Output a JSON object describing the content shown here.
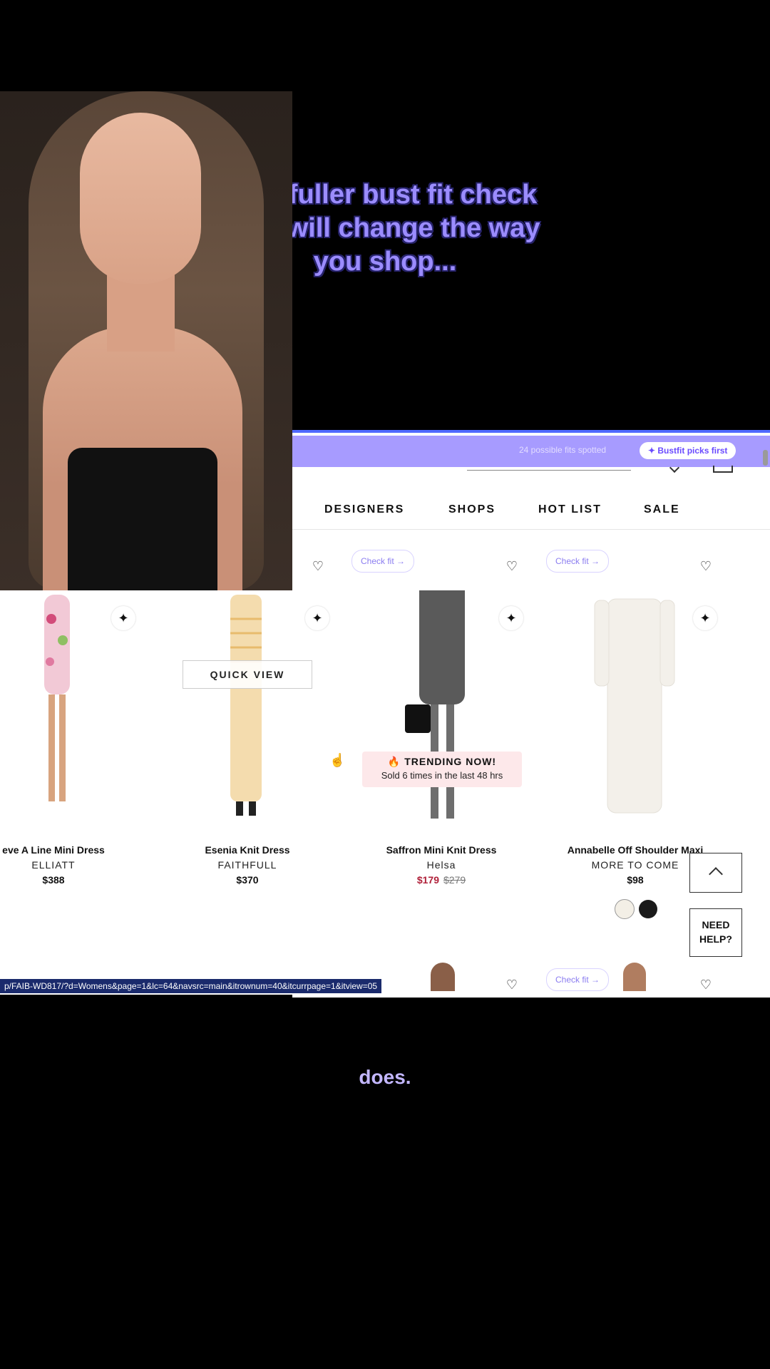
{
  "captions": {
    "top": "this fuller bust fit check tool will change the way you shop...",
    "bottom": "does."
  },
  "extension": {
    "fits_spotted": "24 possible fits spotted",
    "picks_button": "✦ Bustfit picks first"
  },
  "nav": {
    "items": [
      "DESIGNERS",
      "SHOPS",
      "HOT LIST",
      "SALE"
    ]
  },
  "products": [
    {
      "name": "eve A Line Mini Dress",
      "brand": "ELLIATT",
      "price": "$388"
    },
    {
      "name": "Esenia Knit Dress",
      "brand": "FAITHFULL",
      "price": "$370"
    },
    {
      "name": "Saffron Mini Knit Dress",
      "brand": "Helsa",
      "price": "$179",
      "original_price": "$279"
    },
    {
      "name": "Annabelle Off Shoulder Maxi",
      "brand": "MORE TO COME",
      "price": "$98"
    }
  ],
  "check_fit_label": "Check fit →",
  "quick_view": "QUICK VIEW",
  "trending": {
    "title": "🔥 TRENDING NOW!",
    "subtitle": "Sold 6 times in the last 48 hrs"
  },
  "swatches": [
    "#f3efe6",
    "#1a1a1a"
  ],
  "need_help": [
    "NEED",
    "HELP?"
  ],
  "status_url": "p/FAIB-WD817/?d=Womens&page=1&lc=64&navsrc=main&itrownum=40&itcurrpage=1&itview=05",
  "colors": {
    "caption": "#9b8cff",
    "extension_bar": "#a79bff",
    "sale_price": "#b0213a"
  }
}
